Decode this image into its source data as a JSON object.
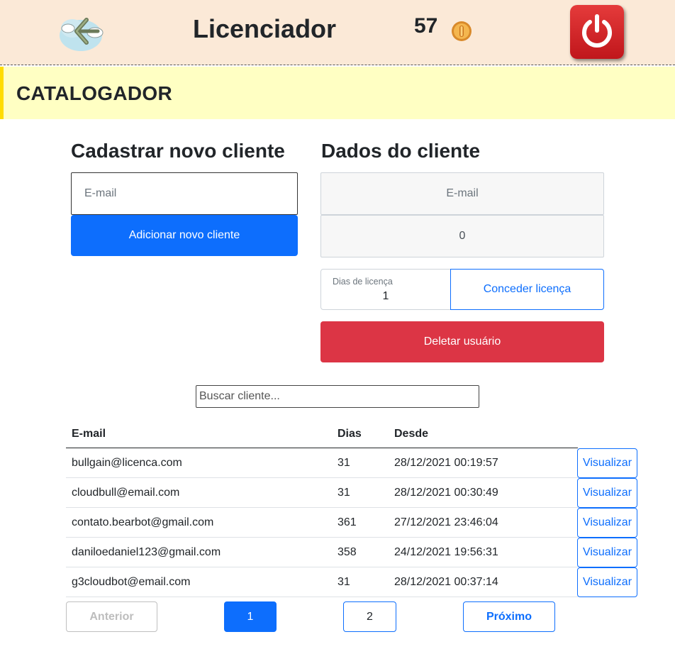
{
  "header": {
    "title": "Licenciador",
    "coins": "57",
    "back_icon": "back-arrow-cloud-icon",
    "coin_icon": "coin-icon",
    "power_icon": "power-icon",
    "colors": {
      "background": "#fbe9d7",
      "power": "#d42a2a"
    }
  },
  "section": {
    "title": "CATALOGADOR",
    "colors": {
      "background": "#ffffc3",
      "accent": "#ffdc00"
    }
  },
  "new_client": {
    "heading": "Cadastrar novo cliente",
    "email_placeholder": "E-mail",
    "add_button": "Adicionar novo cliente"
  },
  "client_data": {
    "heading": "Dados do cliente",
    "email_placeholder": "E-mail",
    "days_value": "0",
    "license_days_label": "Dias de licença",
    "license_days_value": "1",
    "grant_button": "Conceder licença",
    "delete_button": "Deletar usuário"
  },
  "search": {
    "placeholder": "Buscar cliente..."
  },
  "table": {
    "headers": {
      "email": "E-mail",
      "days": "Dias",
      "since": "Desde"
    },
    "view_label": "Visualizar",
    "rows": [
      {
        "email": "bullgain@licenca.com",
        "days": "31",
        "since": "28/12/2021 00:19:57"
      },
      {
        "email": "cloudbull@email.com",
        "days": "31",
        "since": "28/12/2021 00:30:49"
      },
      {
        "email": "contato.bearbot@gmail.com",
        "days": "361",
        "since": "27/12/2021 23:46:04"
      },
      {
        "email": "daniloedaniel123@gmail.com",
        "days": "358",
        "since": "24/12/2021 19:56:31"
      },
      {
        "email": "g3cloudbot@email.com",
        "days": "31",
        "since": "28/12/2021 00:37:14"
      }
    ]
  },
  "pagination": {
    "prev": "Anterior",
    "pages": [
      "1",
      "2"
    ],
    "current": "1",
    "next": "Próximo"
  },
  "colors": {
    "primary": "#0d6efd",
    "danger": "#dc3545"
  }
}
